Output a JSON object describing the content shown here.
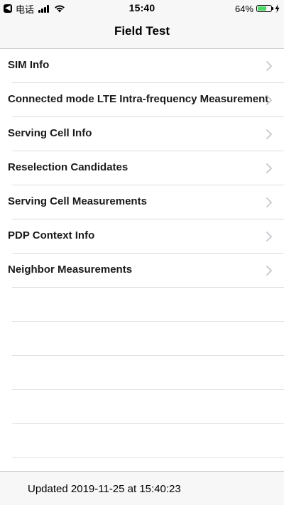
{
  "status_bar": {
    "back_symbol": "◀",
    "carrier": "电话",
    "time": "15:40",
    "battery_percent": "64%",
    "battery_level": 0.64,
    "battery_color": "#4cd964"
  },
  "nav": {
    "title": "Field Test"
  },
  "menu": {
    "items": [
      {
        "label": "SIM Info"
      },
      {
        "label": "Connected mode LTE Intra-frequency Measurement"
      },
      {
        "label": "Serving Cell Info"
      },
      {
        "label": "Reselection Candidates"
      },
      {
        "label": "Serving Cell Measurements"
      },
      {
        "label": "PDP Context Info"
      },
      {
        "label": "Neighbor Measurements"
      }
    ],
    "chevron_icon": "chevron-right-icon"
  },
  "footer": {
    "updated_text": "Updated 2019-11-25 at 15:40:23"
  }
}
